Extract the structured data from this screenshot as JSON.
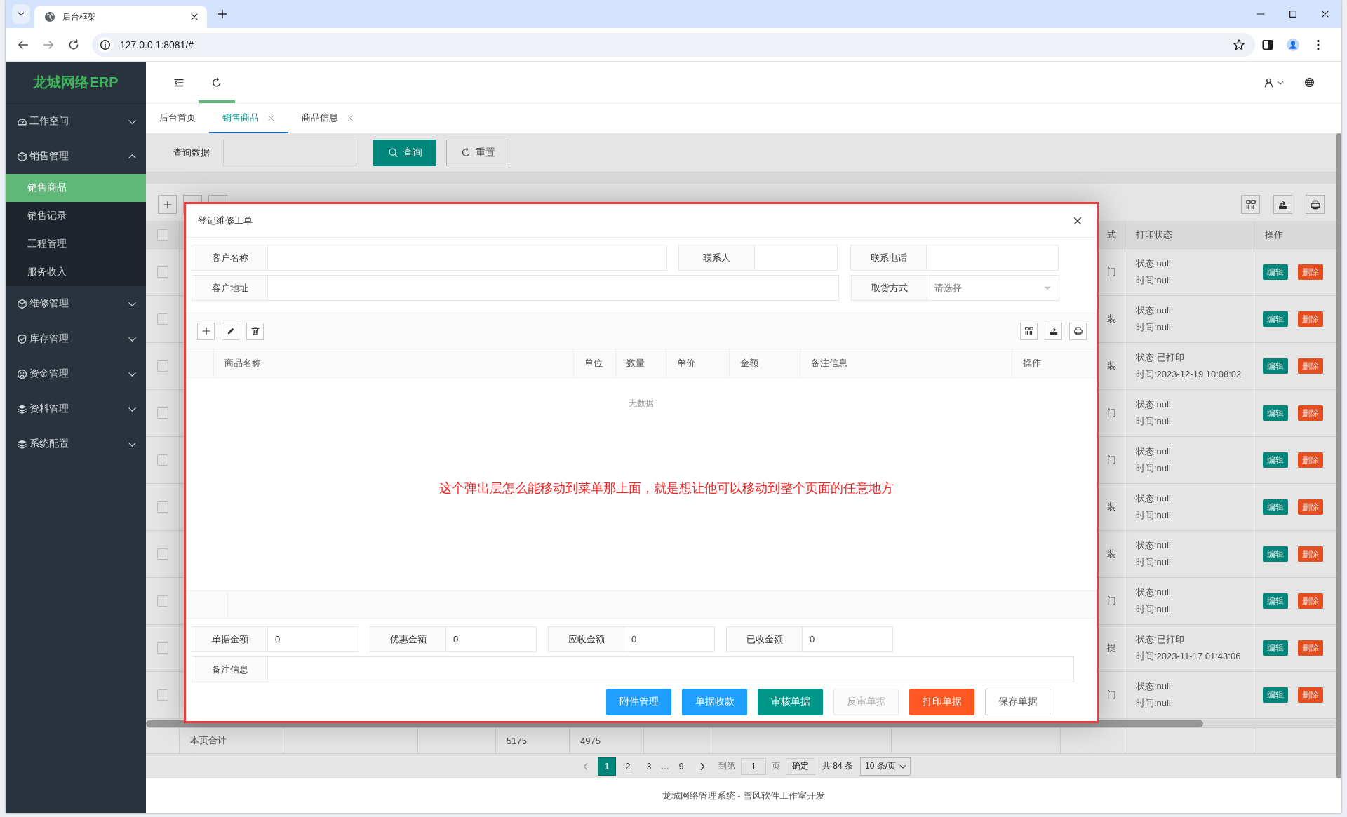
{
  "browser": {
    "tab_title": "后台框架",
    "url": "127.0.0.1:8081/#"
  },
  "sidebar": {
    "logo": "龙城网络ERP",
    "menu": [
      {
        "label": "工作空间",
        "expanded": false
      },
      {
        "label": "销售管理",
        "expanded": true,
        "children": [
          {
            "label": "销售商品",
            "selected": true
          },
          {
            "label": "销售记录",
            "selected": false
          },
          {
            "label": "工程管理",
            "selected": false
          },
          {
            "label": "服务收入",
            "selected": false
          }
        ]
      },
      {
        "label": "维修管理",
        "expanded": false
      },
      {
        "label": "库存管理",
        "expanded": false
      },
      {
        "label": "资金管理",
        "expanded": false
      },
      {
        "label": "资料管理",
        "expanded": false
      },
      {
        "label": "系统配置",
        "expanded": false
      }
    ]
  },
  "header": {
    "tools": [
      {
        "kind": "fold",
        "selected": false
      },
      {
        "kind": "refresh",
        "selected": true
      }
    ]
  },
  "tabs": [
    {
      "label": "后台首页",
      "selected": false,
      "closable": false
    },
    {
      "label": "销售商品",
      "selected": true,
      "closable": true
    },
    {
      "label": "商品信息",
      "selected": false,
      "closable": true
    }
  ],
  "query": {
    "label": "查询数据",
    "search_button": "查询",
    "reset_button": "重置"
  },
  "table": {
    "header_checked": false,
    "columns": {
      "column_10": "式",
      "print_status": "打印状态",
      "actions": "操作"
    },
    "rows": [
      {
        "checked": false,
        "column_10": "门",
        "print_state": "状态:null",
        "print_time": "时间:null",
        "edit": "编辑",
        "delete": "删除"
      },
      {
        "checked": false,
        "column_10": "装",
        "print_state": "状态:null",
        "print_time": "时间:null",
        "edit": "编辑",
        "delete": "删除"
      },
      {
        "checked": false,
        "column_10": "装",
        "print_state": "状态:已打印",
        "print_time": "时间:2023-12-19 10:08:02",
        "edit": "编辑",
        "delete": "删除"
      },
      {
        "checked": false,
        "column_10": "门",
        "print_state": "状态:null",
        "print_time": "时间:null",
        "edit": "编辑",
        "delete": "删除"
      },
      {
        "checked": false,
        "column_10": "门",
        "print_state": "状态:null",
        "print_time": "时间:null",
        "edit": "编辑",
        "delete": "删除"
      },
      {
        "checked": false,
        "column_10": "装",
        "print_state": "状态:null",
        "print_time": "时间:null",
        "edit": "编辑",
        "delete": "删除"
      },
      {
        "checked": false,
        "column_10": "装",
        "print_state": "状态:null",
        "print_time": "时间:null",
        "edit": "编辑",
        "delete": "删除"
      },
      {
        "checked": false,
        "column_10": "门",
        "print_state": "状态:null",
        "print_time": "时间:null",
        "edit": "编辑",
        "delete": "删除"
      },
      {
        "checked": false,
        "column_10": "提",
        "print_state": "状态:已打印",
        "print_time": "时间:2023-11-17 01:43:06",
        "edit": "编辑",
        "delete": "删除"
      },
      {
        "checked": false,
        "column_10": "门",
        "print_state": "状态:null",
        "print_time": "时间:null",
        "edit": "编辑",
        "delete": "删除"
      }
    ],
    "sum_row": {
      "label": "本页合计",
      "column_5": "5175",
      "column_6": "4975"
    }
  },
  "pagination": {
    "pages": [
      {
        "label": "1",
        "kind": "page",
        "selected": true
      },
      {
        "label": "2",
        "kind": "page",
        "selected": false
      },
      {
        "label": "3",
        "kind": "page",
        "selected": false
      },
      {
        "label": "…",
        "kind": "ellipsis"
      },
      {
        "label": "9",
        "kind": "page",
        "selected": false
      }
    ],
    "goto_label": "到第",
    "goto_value": "1",
    "page_unit": "页",
    "confirm": "确定",
    "total": "共 84 条",
    "page_size": "10 条/页"
  },
  "footer": "龙城网络管理系统 - 雪风软件工作室开发",
  "modal": {
    "title": "登记维修工单",
    "form_rows": [
      [
        {
          "label": "客户名称",
          "kind": "text"
        },
        {
          "label": "联系人",
          "kind": "text"
        },
        {
          "label": "联系电话",
          "kind": "text"
        }
      ],
      [
        {
          "label": "客户地址",
          "kind": "text"
        },
        {
          "label": "取货方式",
          "kind": "select",
          "placeholder": "请选择"
        }
      ]
    ],
    "grid_columns": [
      "商品名称",
      "单位",
      "数量",
      "单价",
      "金额",
      "备注信息",
      "操作"
    ],
    "empty_text": "无数据",
    "annotation": "这个弹出层怎么能移动到菜单那上面，就是想让他可以移动到整个页面的任意地方",
    "totals": [
      {
        "label": "单据金额",
        "value": "0"
      },
      {
        "label": "优惠金额",
        "value": "0"
      },
      {
        "label": "应收金额",
        "value": "0"
      },
      {
        "label": "已收金额",
        "value": "0"
      }
    ],
    "remark": {
      "label": "备注信息"
    },
    "buttons": [
      {
        "label": "附件管理",
        "kind": "info"
      },
      {
        "label": "单据收款",
        "kind": "info"
      },
      {
        "label": "审核单据",
        "kind": "primary"
      },
      {
        "label": "反审单据",
        "kind": "disabled"
      },
      {
        "label": "打印单据",
        "kind": "danger"
      },
      {
        "label": "保存单据",
        "kind": "plain"
      }
    ]
  }
}
